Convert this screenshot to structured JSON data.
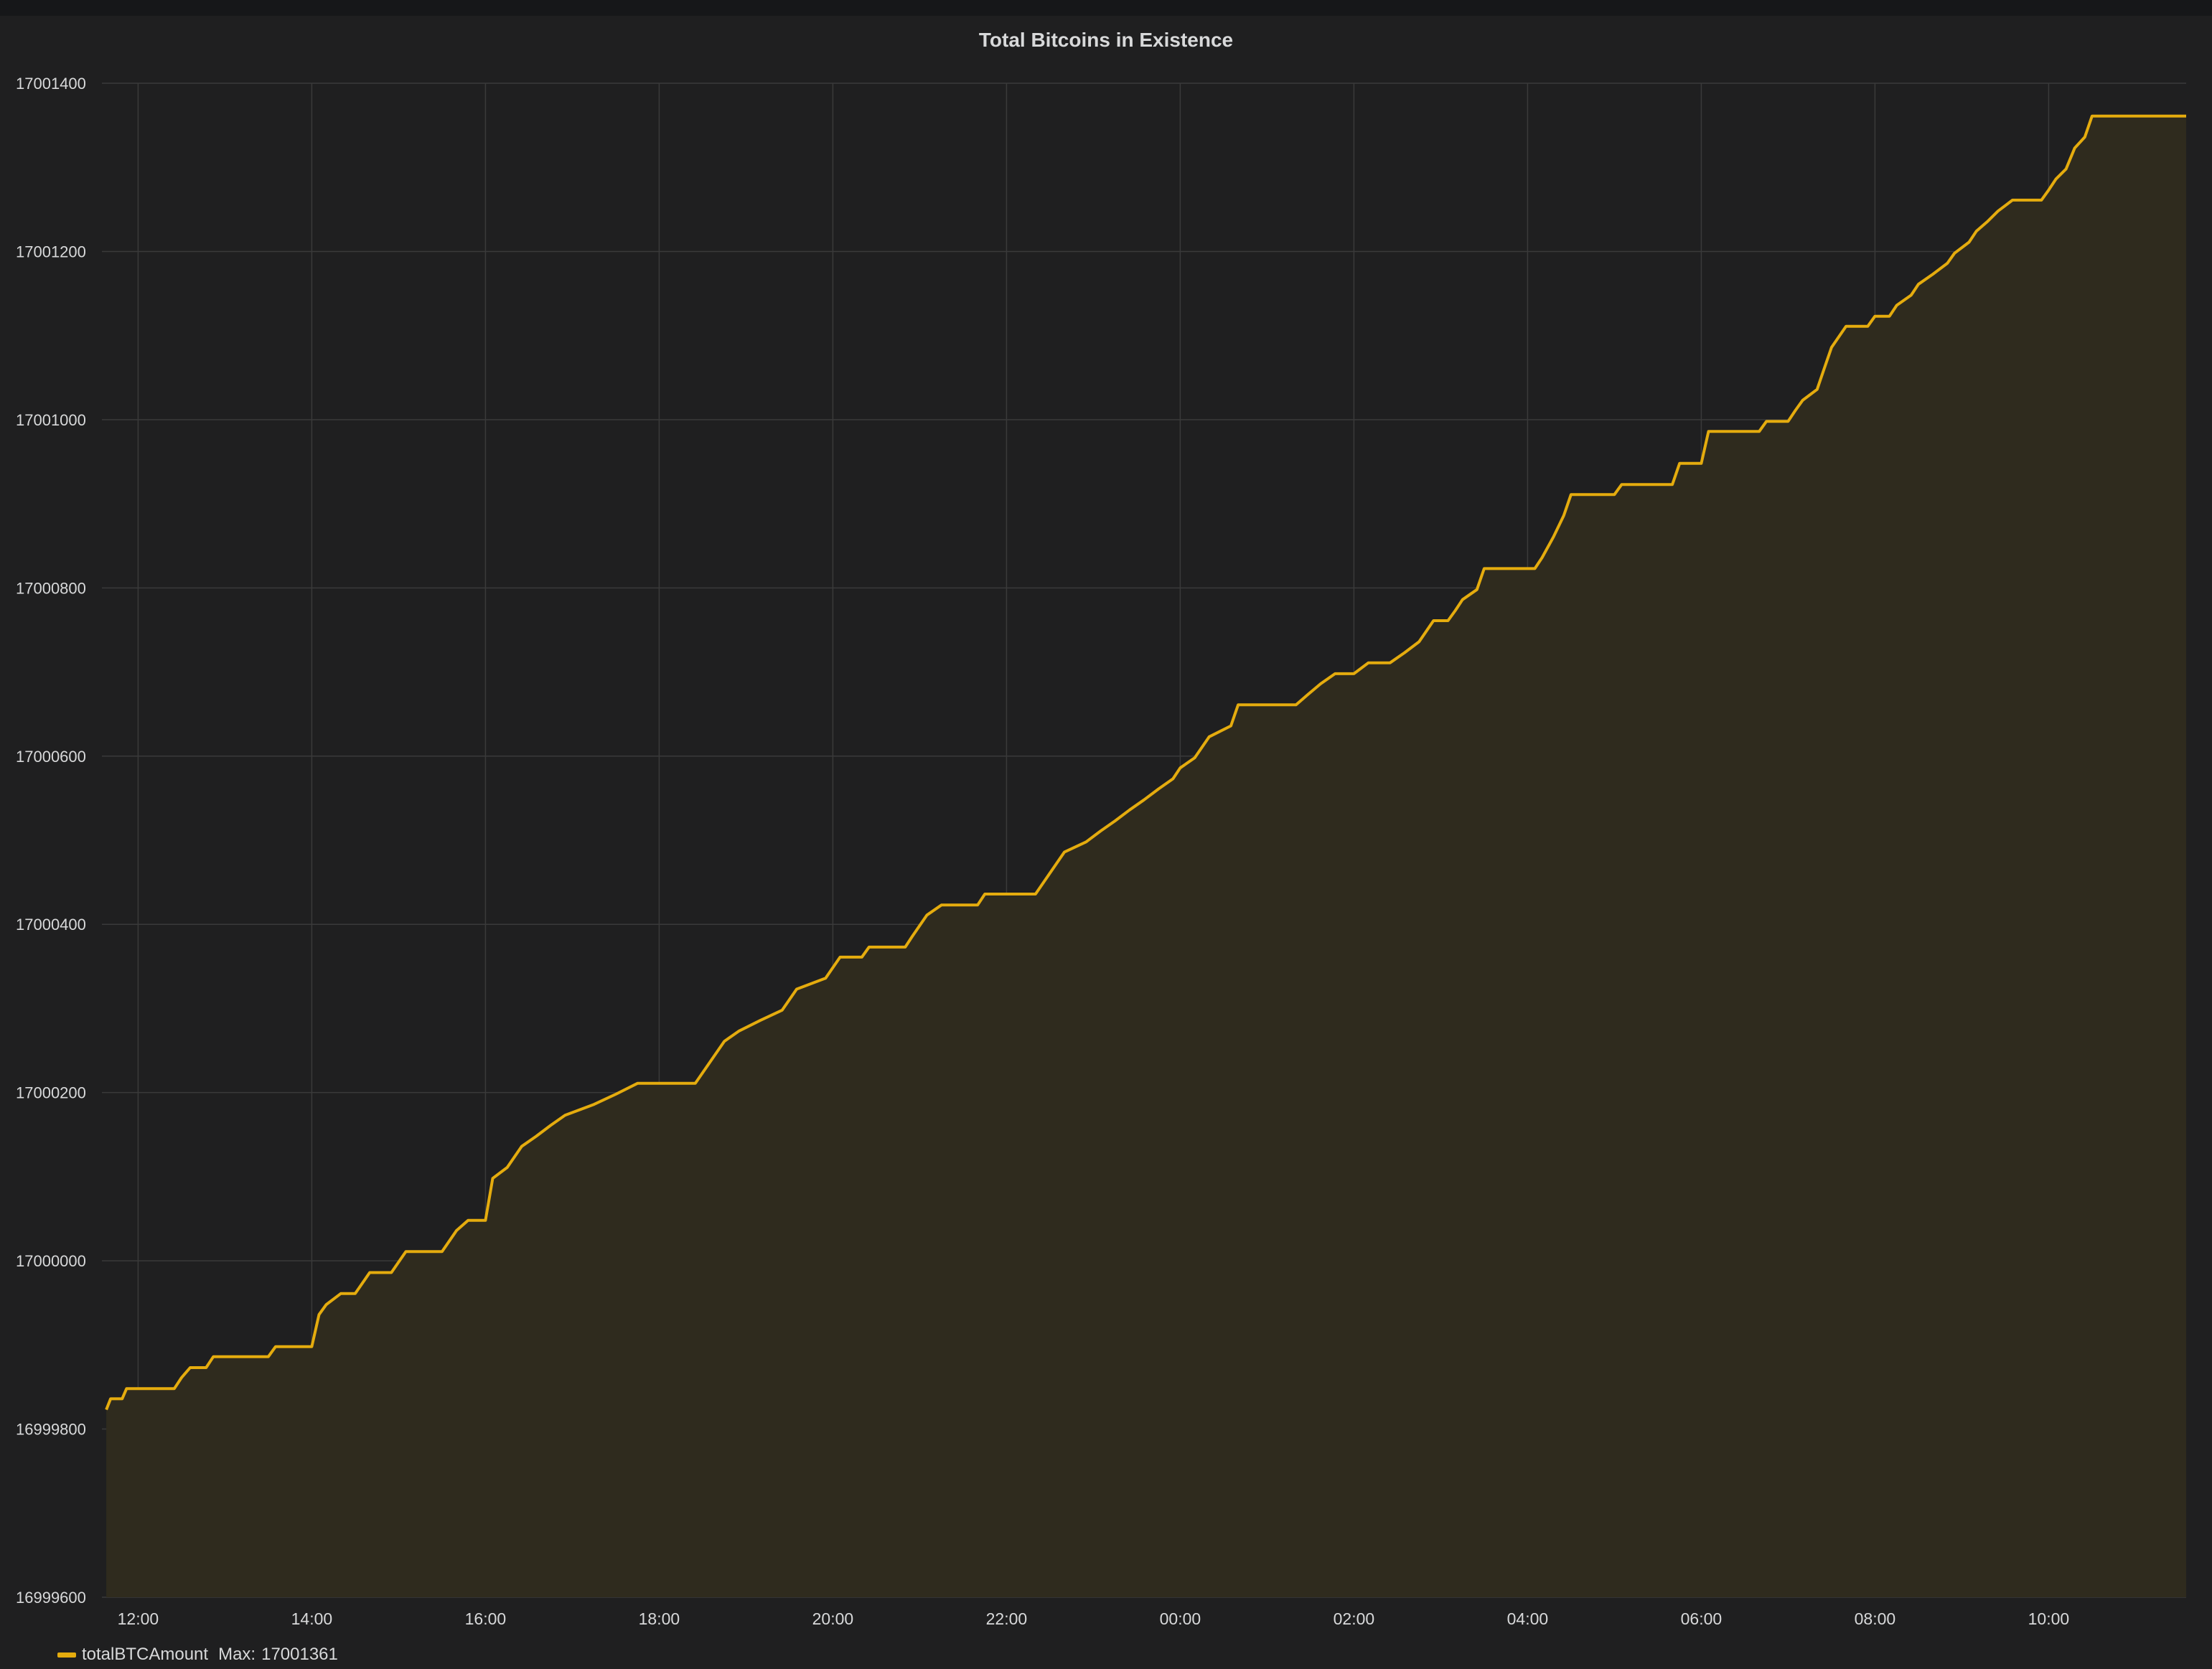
{
  "panel": {
    "title": "Total Bitcoins in Existence"
  },
  "legend": {
    "series_name": "totalBTCAmount",
    "max_label": "Max:",
    "max_value": "17001361"
  },
  "colors": {
    "series": "#e5ac0e",
    "fill": "#2f2b1e",
    "grid": "#3a3a3a",
    "background": "#1f1f20",
    "text": "#d8d9da"
  },
  "chart_data": {
    "type": "area",
    "title": "Total Bitcoins in Existence",
    "xlabel": "",
    "ylabel": "",
    "ylim": [
      16999600,
      17001400
    ],
    "xlim": [
      "11:35",
      "11:35 (+1 day)"
    ],
    "yticks": [
      "16999600",
      "16999800",
      "17000000",
      "17000200",
      "17000400",
      "17000600",
      "17000800",
      "17001000",
      "17001200",
      "17001400"
    ],
    "xticks": [
      "12:00",
      "14:00",
      "16:00",
      "18:00",
      "20:00",
      "22:00",
      "00:00",
      "02:00",
      "04:00",
      "06:00",
      "08:00",
      "10:00"
    ],
    "grid": true,
    "legend_position": "bottom-left",
    "series": [
      {
        "name": "totalBTCAmount",
        "points": [
          [
            "11:38",
            16999823
          ],
          [
            "11:41",
            16999836
          ],
          [
            "11:49",
            16999836
          ],
          [
            "11:52",
            16999848
          ],
          [
            "12:25",
            16999848
          ],
          [
            "12:30",
            16999861
          ],
          [
            "12:36",
            16999873
          ],
          [
            "12:47",
            16999873
          ],
          [
            "12:52",
            16999886
          ],
          [
            "13:30",
            16999886
          ],
          [
            "13:35",
            16999898
          ],
          [
            "14:00",
            16999898
          ],
          [
            "14:05",
            16999936
          ],
          [
            "14:10",
            16999948
          ],
          [
            "14:20",
            16999961
          ],
          [
            "14:30",
            16999961
          ],
          [
            "14:40",
            16999986
          ],
          [
            "14:55",
            16999986
          ],
          [
            "15:05",
            17000011
          ],
          [
            "15:30",
            17000011
          ],
          [
            "15:40",
            17000036
          ],
          [
            "15:48",
            17000048
          ],
          [
            "16:00",
            17000048
          ],
          [
            "16:05",
            17000098
          ],
          [
            "16:15",
            17000111
          ],
          [
            "16:25",
            17000136
          ],
          [
            "16:35",
            17000148
          ],
          [
            "16:45",
            17000161
          ],
          [
            "16:55",
            17000173
          ],
          [
            "17:15",
            17000186
          ],
          [
            "17:30",
            17000198
          ],
          [
            "17:45",
            17000211
          ],
          [
            "18:25",
            17000211
          ],
          [
            "18:35",
            17000236
          ],
          [
            "18:45",
            17000261
          ],
          [
            "18:55",
            17000273
          ],
          [
            "19:10",
            17000286
          ],
          [
            "19:25",
            17000298
          ],
          [
            "19:35",
            17000323
          ],
          [
            "19:55",
            17000336
          ],
          [
            "20:05",
            17000361
          ],
          [
            "20:20",
            17000361
          ],
          [
            "20:25",
            17000373
          ],
          [
            "20:50",
            17000373
          ],
          [
            "20:55",
            17000386
          ],
          [
            "21:05",
            17000411
          ],
          [
            "21:15",
            17000423
          ],
          [
            "21:40",
            17000423
          ],
          [
            "21:45",
            17000436
          ],
          [
            "22:20",
            17000436
          ],
          [
            "22:30",
            17000461
          ],
          [
            "22:40",
            17000486
          ],
          [
            "22:55",
            17000498
          ],
          [
            "23:05",
            17000511
          ],
          [
            "23:15",
            17000523
          ],
          [
            "23:25",
            17000536
          ],
          [
            "23:35",
            17000548
          ],
          [
            "23:45",
            17000561
          ],
          [
            "23:55",
            17000573
          ],
          [
            "00:00",
            17000586
          ],
          [
            "00:10",
            17000598
          ],
          [
            "00:20",
            17000623
          ],
          [
            "00:35",
            17000636
          ],
          [
            "00:40",
            17000661
          ],
          [
            "01:20",
            17000661
          ],
          [
            "01:28",
            17000673
          ],
          [
            "01:37",
            17000686
          ],
          [
            "01:47",
            17000698
          ],
          [
            "02:00",
            17000698
          ],
          [
            "02:10",
            17000711
          ],
          [
            "02:25",
            17000711
          ],
          [
            "02:35",
            17000723
          ],
          [
            "02:45",
            17000736
          ],
          [
            "02:55",
            17000761
          ],
          [
            "03:05",
            17000761
          ],
          [
            "03:10",
            17000773
          ],
          [
            "03:15",
            17000786
          ],
          [
            "03:25",
            17000798
          ],
          [
            "03:30",
            17000823
          ],
          [
            "04:05",
            17000823
          ],
          [
            "04:10",
            17000836
          ],
          [
            "04:18",
            17000861
          ],
          [
            "04:25",
            17000886
          ],
          [
            "04:30",
            17000911
          ],
          [
            "05:00",
            17000911
          ],
          [
            "05:05",
            17000923
          ],
          [
            "05:40",
            17000923
          ],
          [
            "05:45",
            17000948
          ],
          [
            "06:00",
            17000948
          ],
          [
            "06:05",
            17000986
          ],
          [
            "06:40",
            17000986
          ],
          [
            "06:45",
            17000998
          ],
          [
            "07:00",
            17000998
          ],
          [
            "07:05",
            17001011
          ],
          [
            "07:10",
            17001023
          ],
          [
            "07:20",
            17001036
          ],
          [
            "07:25",
            17001061
          ],
          [
            "07:30",
            17001086
          ],
          [
            "07:40",
            17001111
          ],
          [
            "07:55",
            17001111
          ],
          [
            "08:00",
            17001123
          ],
          [
            "08:10",
            17001123
          ],
          [
            "08:15",
            17001136
          ],
          [
            "08:25",
            17001148
          ],
          [
            "08:30",
            17001161
          ],
          [
            "08:40",
            17001173
          ],
          [
            "08:50",
            17001186
          ],
          [
            "08:55",
            17001198
          ],
          [
            "09:05",
            17001211
          ],
          [
            "09:10",
            17001224
          ],
          [
            "09:18",
            17001236
          ],
          [
            "09:25",
            17001248
          ],
          [
            "09:35",
            17001261
          ],
          [
            "09:55",
            17001261
          ],
          [
            "10:00",
            17001273
          ],
          [
            "10:05",
            17001286
          ],
          [
            "10:12",
            17001298
          ],
          [
            "10:18",
            17001323
          ],
          [
            "10:25",
            17001336
          ],
          [
            "10:30",
            17001361
          ],
          [
            "11:35",
            17001361
          ]
        ]
      }
    ]
  }
}
